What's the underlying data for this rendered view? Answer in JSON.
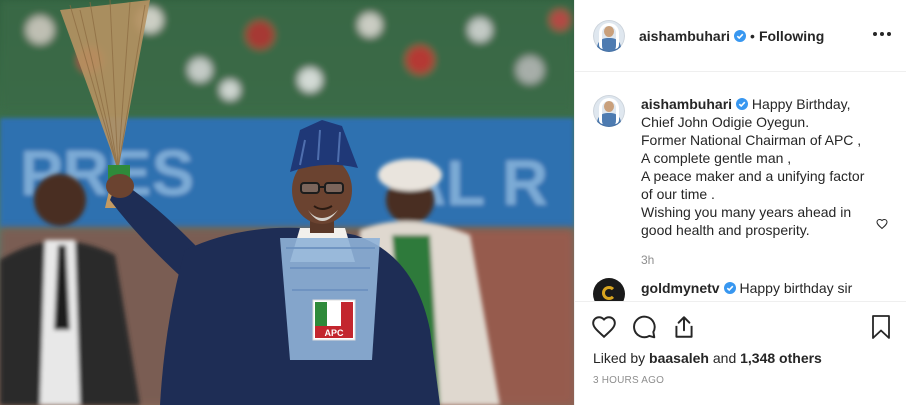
{
  "post": {
    "image_alt": "Man in blue agbada and cap holding a broom",
    "username": "aishambuhari",
    "separator": "•",
    "follow_status": "Following",
    "more_icon": "more-options-icon",
    "caption_lines": [
      "Happy Birthday,",
      "Chief John Odigie Oyegun.",
      "Former National Chairman of APC ,",
      "A complete gentle man ,",
      "A peace maker and a unifying factor",
      "of our time .",
      "Wishing you many years ahead in",
      "good health and prosperity."
    ],
    "caption_time": "3h",
    "comments": [
      {
        "username": "goldmynetv",
        "text": "Happy birthday sir"
      }
    ],
    "likes_prefix": "Liked by",
    "likes_user": "baasaleh",
    "likes_and": "and",
    "likes_others": "1,348 others",
    "posted_ago": "3 HOURS AGO",
    "badge_text": "APC"
  },
  "icons": [
    "like-icon",
    "comment-icon",
    "share-icon",
    "bookmark-icon",
    "verified-badge-icon"
  ],
  "colors": {
    "verified": "#3897f0",
    "text": "#262626",
    "muted": "#8e8e8e",
    "border": "#efefef"
  }
}
